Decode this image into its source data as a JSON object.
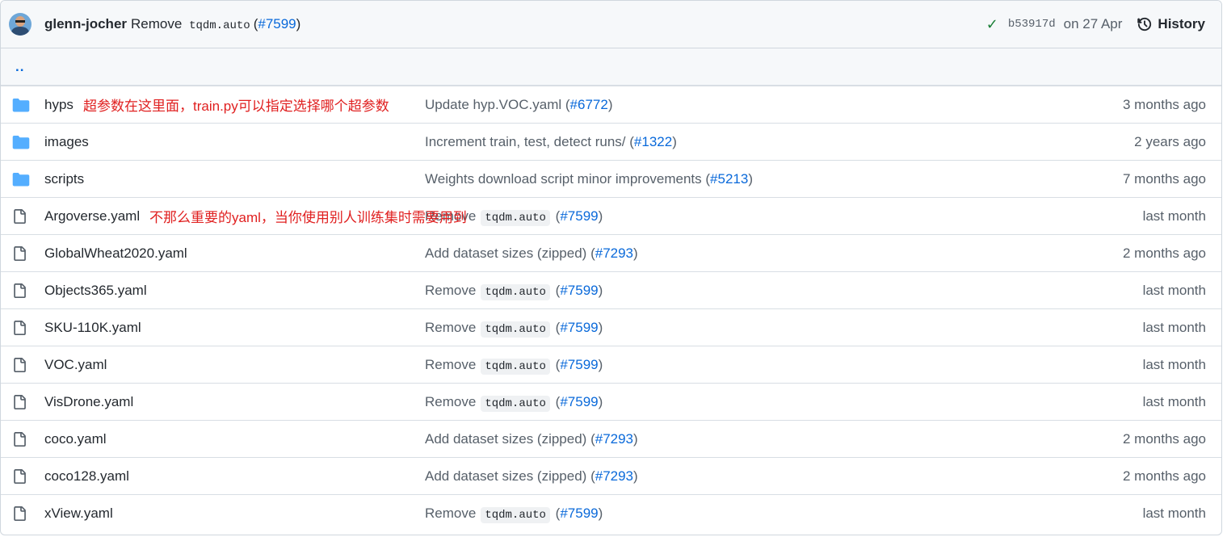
{
  "header": {
    "author": "glenn-jocher",
    "message_prefix": "Remove",
    "message_code": "tqdm.auto",
    "pr_open": "(",
    "pr_link": "#7599",
    "pr_close": ")",
    "sha": "b53917d",
    "date": "on 27 Apr",
    "history_label": "History"
  },
  "parent_link": "..",
  "rows": [
    {
      "type": "dir",
      "name": "hyps",
      "note": "超参数在这里面，train.py可以指定选择哪个超参数",
      "commit_text": "Update hyp.VOC.yaml",
      "commit_code": "",
      "pr": "#6772",
      "age": "3 months ago"
    },
    {
      "type": "dir",
      "name": "images",
      "note": "",
      "commit_text": "Increment train, test, detect runs/",
      "commit_code": "",
      "pr": "#1322",
      "age": "2 years ago"
    },
    {
      "type": "dir",
      "name": "scripts",
      "note": "",
      "commit_text": "Weights download script minor improvements",
      "commit_code": "",
      "pr": "#5213",
      "age": "7 months ago"
    },
    {
      "type": "file",
      "name": "Argoverse.yaml",
      "note": "不那么重要的yaml，当你使用别人训练集时需要用到",
      "commit_text": "Remove",
      "commit_code": "tqdm.auto",
      "pr": "#7599",
      "age": "last month"
    },
    {
      "type": "file",
      "name": "GlobalWheat2020.yaml",
      "note": "",
      "commit_text": "Add dataset sizes (zipped)",
      "commit_code": "",
      "pr": "#7293",
      "age": "2 months ago"
    },
    {
      "type": "file",
      "name": "Objects365.yaml",
      "note": "",
      "commit_text": "Remove",
      "commit_code": "tqdm.auto",
      "pr": "#7599",
      "age": "last month"
    },
    {
      "type": "file",
      "name": "SKU-110K.yaml",
      "note": "",
      "commit_text": "Remove",
      "commit_code": "tqdm.auto",
      "pr": "#7599",
      "age": "last month"
    },
    {
      "type": "file",
      "name": "VOC.yaml",
      "note": "",
      "commit_text": "Remove",
      "commit_code": "tqdm.auto",
      "pr": "#7599",
      "age": "last month"
    },
    {
      "type": "file",
      "name": "VisDrone.yaml",
      "note": "",
      "commit_text": "Remove",
      "commit_code": "tqdm.auto",
      "pr": "#7599",
      "age": "last month"
    },
    {
      "type": "file",
      "name": "coco.yaml",
      "note": "",
      "commit_text": "Add dataset sizes (zipped)",
      "commit_code": "",
      "pr": "#7293",
      "age": "2 months ago"
    },
    {
      "type": "file",
      "name": "coco128.yaml",
      "note": "",
      "commit_text": "Add dataset sizes (zipped)",
      "commit_code": "",
      "pr": "#7293",
      "age": "2 months ago"
    },
    {
      "type": "file",
      "name": "xView.yaml",
      "note": "",
      "commit_text": "Remove",
      "commit_code": "tqdm.auto",
      "pr": "#7599",
      "age": "last month"
    }
  ],
  "colors": {
    "folder": "#54aeff",
    "file": "#57606a",
    "link": "#0969da",
    "note": "#e02020",
    "check": "#1a7f37"
  }
}
